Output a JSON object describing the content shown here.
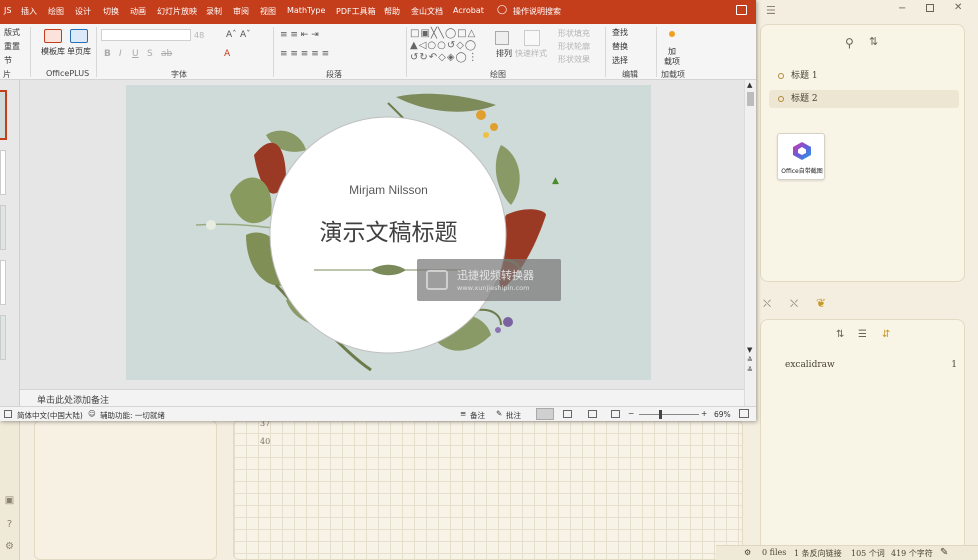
{
  "ppt": {
    "tabs": [
      "JS",
      "插入",
      "绘图",
      "设计",
      "切换",
      "动画",
      "幻灯片放映",
      "录制",
      "审阅",
      "视图",
      "MathType",
      "PDF工具箱",
      "帮助",
      "金山文档",
      "Acrobat"
    ],
    "search": "操作说明搜索",
    "ribbon": {
      "layout": "版式",
      "reset": "重置",
      "section": "节",
      "slides_group": "片",
      "template_lib": "模板库",
      "single_page": "单页库",
      "officeplus": "OfficePLUS",
      "font_size": "48",
      "font_group": "字体",
      "paragraph_group": "段落",
      "arrange": "排列",
      "quick_styles": "快速样式",
      "shape_fill": "形状填充",
      "shape_outline": "形状轮廓",
      "shape_effects": "形状效果",
      "drawing_group": "绘图",
      "find": "查找",
      "replace": "替换",
      "select": "选择",
      "editing_group": "编辑",
      "add_item": "加",
      "add_item2": "载项",
      "addins_group": "加载项"
    },
    "slide": {
      "subtitle": "Mirjam Nilsson",
      "title": "演示文稿标题"
    },
    "watermark": {
      "title": "迅捷视频转换器",
      "url": "www.xunjieshipin.com"
    },
    "notes_placeholder": "单击此处添加备注",
    "status": {
      "language": "简体中文(中国大陆)",
      "accessibility": "辅助功能: 一切就绪",
      "notes": "备注",
      "comments": "批注",
      "zoom": "69%"
    }
  },
  "obsidian": {
    "outline": [
      "标题 1",
      "标题 2"
    ],
    "office_image_label": "Office自带截图",
    "files": [
      {
        "name": "excalidraw",
        "count": "1"
      }
    ],
    "editor_rows": [
      "37",
      "40"
    ],
    "status": {
      "files": "0 files",
      "backlinks": "1 条反向链接",
      "words": "105 个词",
      "chars": "419 个字符"
    }
  },
  "colors": {
    "ppt_accent": "#c43e1c",
    "slide_bg": "#cfdbd8",
    "obsidian_bg": "#f3eedf",
    "outline_dot": "#b08a3a"
  }
}
